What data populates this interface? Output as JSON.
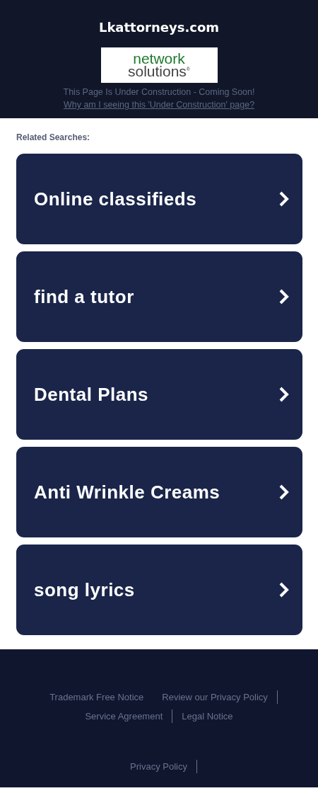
{
  "header": {
    "site_title": "Lkattorneys.com",
    "logo": {
      "line_1": "network",
      "line_2": "solutions",
      "mark": "®"
    },
    "notice": "This Page Is Under Construction - Coming Soon!",
    "notice_link": "Why am I seeing this 'Under Construction' page?"
  },
  "related": {
    "heading": "Related Searches:",
    "items": [
      {
        "label": "Online classifieds"
      },
      {
        "label": "find a tutor"
      },
      {
        "label": "Dental Plans"
      },
      {
        "label": "Anti Wrinkle Creams"
      },
      {
        "label": "song lyrics"
      }
    ]
  },
  "footer": {
    "links": [
      {
        "label": "Trademark Free Notice",
        "separator_after": false
      },
      {
        "label": "Review our Privacy Policy",
        "separator_after": true
      },
      {
        "label": "Service Agreement",
        "separator_after": true
      },
      {
        "label": "Legal Notice",
        "separator_after": false
      }
    ],
    "bottom_links": [
      {
        "label": "Privacy Policy",
        "separator_after": true
      }
    ]
  }
}
